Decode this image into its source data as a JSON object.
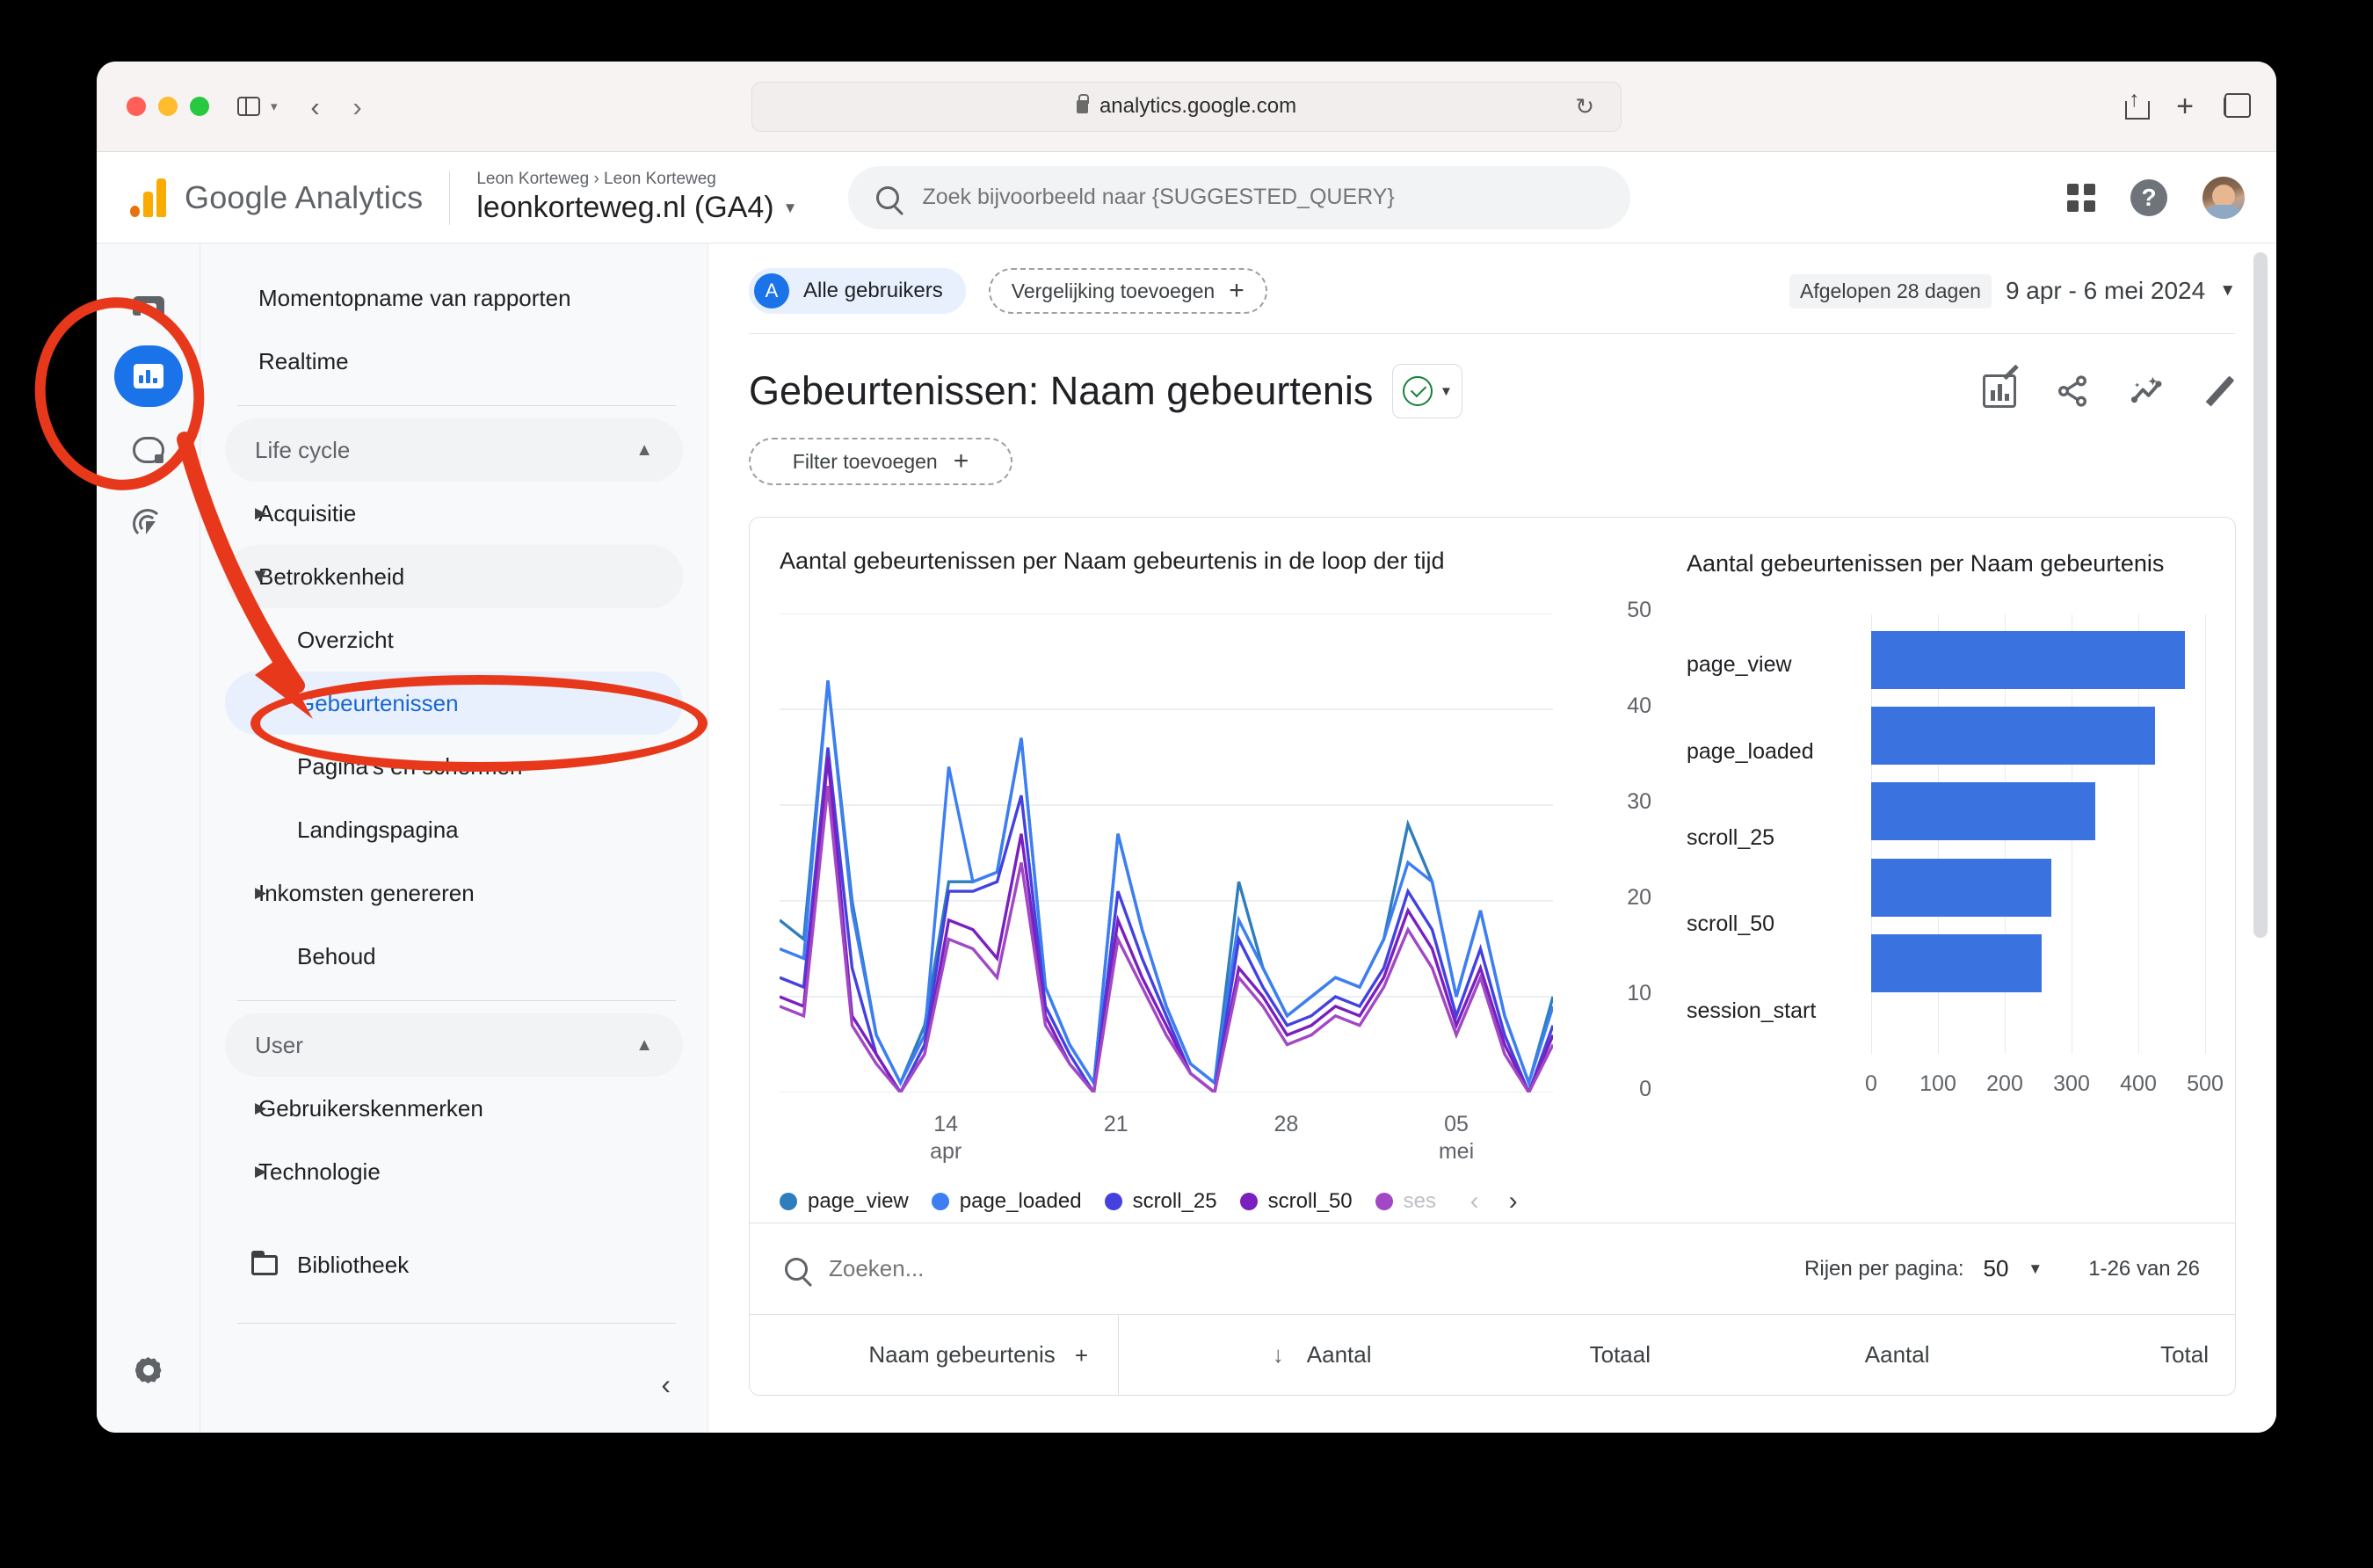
{
  "browser": {
    "url": "analytics.google.com",
    "lock_icon": "lock-icon",
    "reload_icon": "reload-icon",
    "back_icon": "back-arrow-icon",
    "forward_icon": "forward-arrow-icon",
    "sidebar_icon": "sidebar-toggle-icon",
    "share_icon": "share-icon",
    "new_tab_icon": "plus-icon",
    "tabs_icon": "tab-overview-icon"
  },
  "header": {
    "product_name": "Google Analytics",
    "breadcrumb": "Leon Korteweg › Leon Korteweg",
    "property": "leonkorteweg.nl (GA4)",
    "search_placeholder": "Zoek bijvoorbeeld naar {SUGGESTED_QUERY}",
    "apps_icon": "apps-grid-icon",
    "help_icon": "help-icon",
    "avatar_icon": "user-avatar"
  },
  "rail": {
    "items": [
      {
        "name": "home-icon",
        "active": false
      },
      {
        "name": "reports-icon",
        "active": true
      },
      {
        "name": "explore-icon",
        "active": false
      },
      {
        "name": "advertising-icon",
        "active": false
      }
    ],
    "settings_icon": "gear-icon"
  },
  "sidebar": {
    "items": [
      {
        "label": "Momentopname van rapporten",
        "type": "item"
      },
      {
        "label": "Realtime",
        "type": "item"
      },
      {
        "label": "Life cycle",
        "type": "section"
      },
      {
        "label": "Acquisitie",
        "type": "group"
      },
      {
        "label": "Betrokkenheid",
        "type": "group",
        "expanded": true
      },
      {
        "label": "Overzicht",
        "type": "sub"
      },
      {
        "label": "Gebeurtenissen",
        "type": "sub",
        "selected": true
      },
      {
        "label": "Pagina's en schermen",
        "type": "sub"
      },
      {
        "label": "Landingspagina",
        "type": "sub"
      },
      {
        "label": "Inkomsten genereren",
        "type": "group"
      },
      {
        "label": "Behoud",
        "type": "sub"
      },
      {
        "label": "User",
        "type": "section"
      },
      {
        "label": "Gebruikerskenmerken",
        "type": "group"
      },
      {
        "label": "Technologie",
        "type": "group"
      },
      {
        "label": "Bibliotheek",
        "type": "library"
      }
    ],
    "collapse_icon": "collapse-left-icon"
  },
  "toolbar": {
    "audience_initial": "A",
    "audience_label": "Alle gebruikers",
    "add_comparison": "Vergelijking toevoegen",
    "date_preset": "Afgelopen 28 dagen",
    "date_range": "9 apr - 6 mei 2024"
  },
  "report": {
    "title": "Gebeurtenissen: Naam gebeurtenis",
    "add_filter": "Filter toevoegen",
    "actions": [
      {
        "name": "customize-report-icon"
      },
      {
        "name": "share-icon"
      },
      {
        "name": "insights-icon"
      },
      {
        "name": "edit-pencil-icon"
      }
    ]
  },
  "table": {
    "search_placeholder": "Zoeken...",
    "rows_per_page_label": "Rijen per pagina:",
    "rows_per_page_value": "50",
    "row_range": "1-26 van 26",
    "columns": [
      "Naam gebeurtenis",
      "Aantal",
      "Totaal",
      "Aantal",
      "Total"
    ],
    "sort_icon": "sort-descending-icon",
    "add_dimension_icon": "plus-icon"
  },
  "chart_data": [
    {
      "type": "line",
      "title": "Aantal gebeurtenissen per Naam gebeurtenis in de loop der tijd",
      "xlabel": "",
      "ylabel": "",
      "ylim": [
        0,
        50
      ],
      "yticks": [
        0,
        10,
        20,
        30,
        40,
        50
      ],
      "xticks": [
        "14\napr",
        "21",
        "28",
        "05\nmei"
      ],
      "xtick_positions": [
        0.215,
        0.435,
        0.655,
        0.875
      ],
      "grid": true,
      "legend_position": "bottom",
      "legend_truncated_last": "ses",
      "series": [
        {
          "name": "page_view",
          "color": "#2e7dbd",
          "values": [
            18,
            16,
            43,
            20,
            6,
            1,
            7,
            22,
            22,
            23,
            37,
            11,
            5,
            1,
            27,
            17,
            9,
            3,
            1,
            22,
            13,
            8,
            10,
            12,
            11,
            16,
            28,
            22,
            10,
            19,
            8,
            1,
            10
          ]
        },
        {
          "name": "page_loaded",
          "color": "#3d7ef2",
          "values": [
            15,
            14,
            43,
            19,
            6,
            1,
            6,
            34,
            22,
            23,
            37,
            11,
            5,
            1,
            27,
            17,
            9,
            3,
            1,
            18,
            13,
            8,
            10,
            12,
            11,
            16,
            24,
            22,
            10,
            19,
            8,
            1,
            9
          ]
        },
        {
          "name": "scroll_25",
          "color": "#4441e0",
          "values": [
            12,
            11,
            36,
            13,
            4,
            0,
            5,
            21,
            21,
            22,
            31,
            9,
            4,
            0,
            21,
            14,
            8,
            2,
            0,
            16,
            11,
            7,
            8,
            10,
            9,
            13,
            21,
            17,
            8,
            15,
            6,
            0,
            7
          ]
        },
        {
          "name": "scroll_50",
          "color": "#7a1fc0",
          "values": [
            10,
            9,
            35,
            8,
            4,
            0,
            4,
            18,
            17,
            14,
            27,
            8,
            3,
            0,
            18,
            12,
            7,
            2,
            0,
            13,
            10,
            6,
            7,
            9,
            8,
            12,
            19,
            15,
            7,
            13,
            5,
            0,
            6
          ]
        },
        {
          "name": "session_start",
          "color": "#a248c4",
          "values": [
            9,
            8,
            32,
            7,
            3,
            0,
            4,
            16,
            15,
            12,
            24,
            7,
            3,
            0,
            16,
            11,
            6,
            2,
            0,
            12,
            9,
            5,
            6,
            8,
            7,
            11,
            17,
            13,
            6,
            12,
            4,
            0,
            5
          ]
        }
      ]
    },
    {
      "type": "bar",
      "orientation": "horizontal",
      "title": "Aantal gebeurtenissen per Naam gebeurtenis",
      "categories": [
        "page_view",
        "page_loaded",
        "scroll_25",
        "scroll_50",
        "session_start"
      ],
      "values": [
        470,
        425,
        335,
        270,
        255
      ],
      "xticks": [
        0,
        100,
        200,
        300,
        400,
        500
      ],
      "xlim": [
        0,
        500
      ],
      "color": "#3a73df",
      "grid": true
    }
  ],
  "annotations": {
    "rail_highlight": "red-ellipse-around-reports-icon",
    "nav_highlight": "red-ellipse-around-gebeurtenissen",
    "arrow": "red-arrow-pointing-to-gebeurtenissen"
  }
}
